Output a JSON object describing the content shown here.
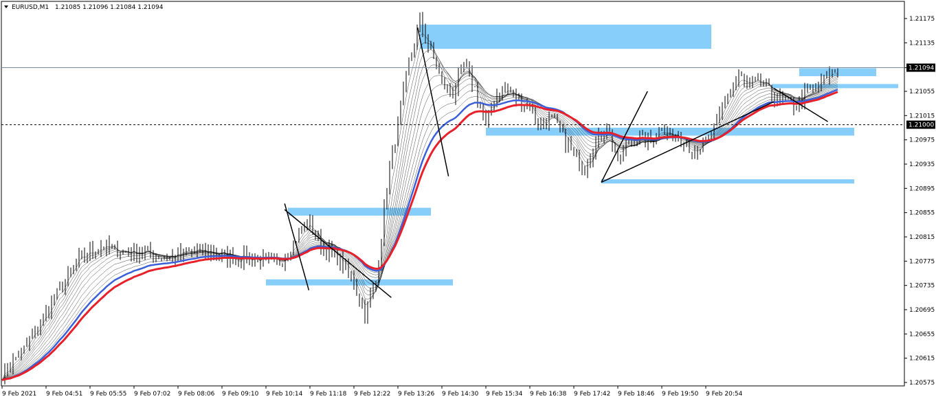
{
  "header": {
    "symbol_timeframe": "EURUSD,M1",
    "ohlc": "1.21085 1.21096 1.21084 1.21094"
  },
  "colors": {
    "background": "#ffffff",
    "candle": "#000000",
    "zone": "#87CEFA",
    "ema_red": "#e8202a",
    "ema_blue": "#3a5fd8",
    "ribbon": "#000000",
    "bid_line": "#7a8aa0",
    "price_tag_bg": "#000000"
  },
  "chart_data": {
    "type": "candlestick",
    "symbol": "EURUSD",
    "timeframe": "M1",
    "y_ticks": [
      "1.21175",
      "1.21135",
      "1.21094",
      "1.21055",
      "1.21015",
      "1.20975",
      "1.20935",
      "1.20895",
      "1.20855",
      "1.20815",
      "1.20775",
      "1.20735",
      "1.20695",
      "1.20655",
      "1.20615",
      "1.20575"
    ],
    "y_range": [
      1.2057,
      1.2119
    ],
    "x_ticks": [
      "9 Feb 2021",
      "9 Feb 04:51",
      "9 Feb 05:55",
      "9 Feb 07:02",
      "9 Feb 08:06",
      "9 Feb 09:10",
      "9 Feb 10:14",
      "9 Feb 11:18",
      "9 Feb 12:22",
      "9 Feb 13:26",
      "9 Feb 14:30",
      "9 Feb 15:34",
      "9 Feb 16:38",
      "9 Feb 17:42",
      "9 Feb 18:46",
      "9 Feb 19:50",
      "9 Feb 20:54"
    ],
    "current_price": "1.21094",
    "horizontal_level": "1.21000",
    "price_path": [
      [
        0,
        1.2059
      ],
      [
        2,
        1.2063
      ],
      [
        5,
        1.2072
      ],
      [
        7,
        1.2078
      ],
      [
        9,
        1.208
      ],
      [
        11,
        1.2079
      ],
      [
        13,
        1.2079
      ],
      [
        15,
        1.2078
      ],
      [
        17,
        1.2079
      ],
      [
        19,
        1.2079
      ],
      [
        21,
        1.2078
      ],
      [
        23,
        1.2078
      ],
      [
        25,
        1.2077
      ],
      [
        26,
        1.2079
      ],
      [
        27,
        1.2082
      ],
      [
        28,
        1.2084
      ],
      [
        29,
        1.208
      ],
      [
        30,
        1.2079
      ],
      [
        31,
        1.2077
      ],
      [
        32,
        1.2074
      ],
      [
        33,
        1.2069
      ],
      [
        34,
        1.2074
      ],
      [
        35,
        1.209
      ],
      [
        36,
        1.21
      ],
      [
        37,
        1.211
      ],
      [
        38,
        1.2117
      ],
      [
        39,
        1.2112
      ],
      [
        40,
        1.2107
      ],
      [
        41,
        1.2105
      ],
      [
        42,
        1.211
      ],
      [
        43,
        1.2106
      ],
      [
        44,
        1.21
      ],
      [
        45,
        1.2105
      ],
      [
        46,
        1.2106
      ],
      [
        47,
        1.2104
      ],
      [
        48,
        1.2103
      ],
      [
        49,
        1.21
      ],
      [
        50,
        1.2101
      ],
      [
        51,
        1.2098
      ],
      [
        52,
        1.2095
      ],
      [
        53,
        1.2093
      ],
      [
        54,
        1.2097
      ],
      [
        55,
        1.21
      ],
      [
        56,
        1.2094
      ],
      [
        57,
        1.2097
      ],
      [
        58,
        1.2098
      ],
      [
        59,
        1.2097
      ],
      [
        60,
        1.21
      ],
      [
        61,
        1.2098
      ],
      [
        62,
        1.2097
      ],
      [
        63,
        1.2096
      ],
      [
        64,
        1.2097
      ],
      [
        65,
        1.21
      ],
      [
        66,
        1.2105
      ],
      [
        67,
        1.2108
      ],
      [
        68,
        1.2106
      ],
      [
        69,
        1.2107
      ],
      [
        70,
        1.2105
      ],
      [
        71,
        1.2104
      ],
      [
        72,
        1.2103
      ],
      [
        73,
        1.2105
      ],
      [
        74,
        1.2106
      ],
      [
        75,
        1.2108
      ],
      [
        76,
        1.2109
      ]
    ],
    "zones": [
      {
        "from_bar": 38,
        "to_bar": 64.5,
        "low": 1.21125,
        "high": 1.21165
      },
      {
        "from_bar": 26,
        "to_bar": 39,
        "low": 1.2085,
        "high": 1.20863
      },
      {
        "from_bar": 24,
        "to_bar": 41,
        "low": 1.20735,
        "high": 1.20745
      },
      {
        "from_bar": 44,
        "to_bar": 77.5,
        "low": 1.20982,
        "high": 1.20995
      },
      {
        "from_bar": 54.5,
        "to_bar": 77.5,
        "low": 1.20903,
        "high": 1.2091
      },
      {
        "from_bar": 72.5,
        "to_bar": 79.5,
        "low": 1.2108,
        "high": 1.21093
      },
      {
        "from_bar": 70,
        "to_bar": 81.5,
        "low": 1.21062,
        "high": 1.21067
      }
    ],
    "trendlines": [
      {
        "from": [
          25.7,
          1.2087
        ],
        "to": [
          27.9,
          1.20727
        ]
      },
      {
        "from": [
          25.7,
          1.2086
        ],
        "to": [
          35.4,
          1.20715
        ]
      },
      {
        "from": [
          37.8,
          1.2116
        ],
        "to": [
          40.6,
          1.20915
        ]
      },
      {
        "from": [
          54.5,
          1.20905
        ],
        "to": [
          58.7,
          1.21055
        ]
      },
      {
        "from": [
          54.5,
          1.20905
        ],
        "to": [
          70.2,
          1.21038
        ]
      },
      {
        "from": [
          70.2,
          1.2106
        ],
        "to": [
          75.1,
          1.21005
        ]
      }
    ]
  }
}
